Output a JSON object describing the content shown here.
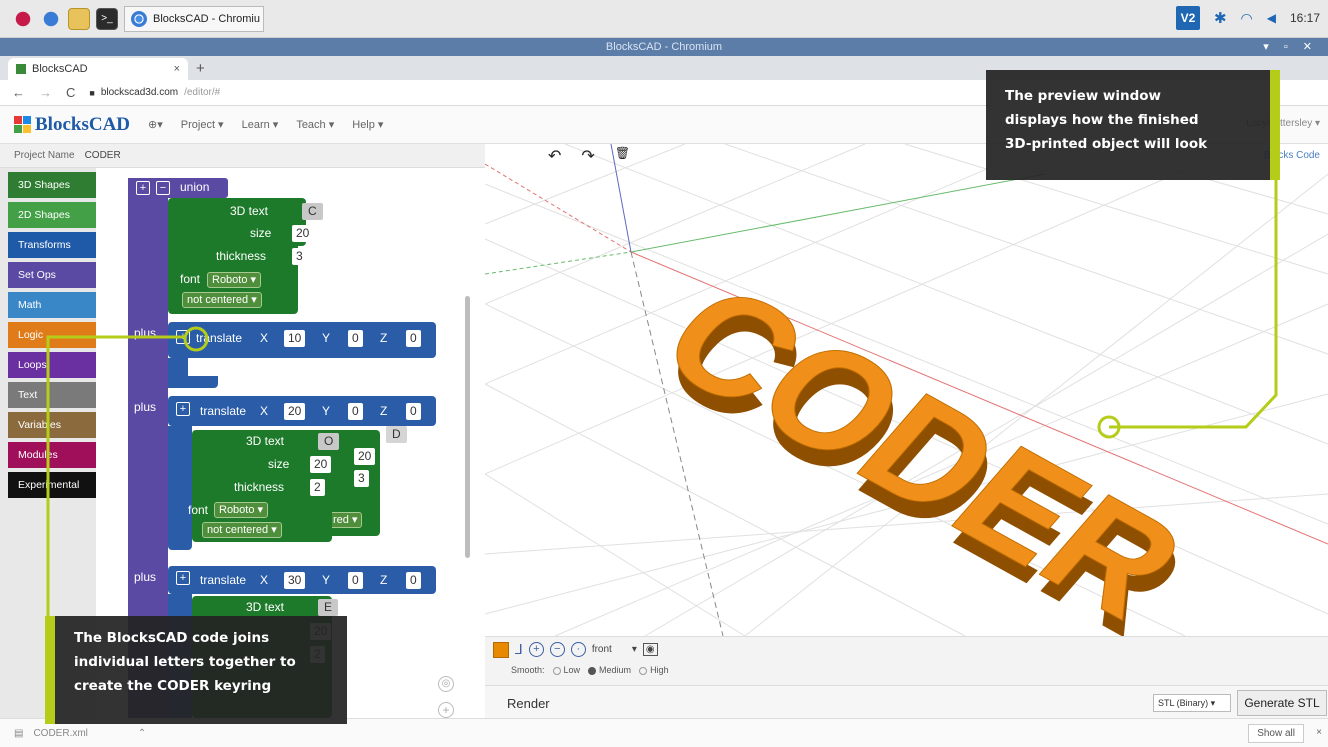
{
  "taskbar": {
    "task_label": "BlocksCAD - Chromiu",
    "vnc_label": "V2",
    "clock": "16:17"
  },
  "window": {
    "title": "BlocksCAD - Chromium",
    "controls": "▾ ▫ ✕"
  },
  "browser": {
    "tab_title": "BlocksCAD",
    "url_host": "blockscad3d.com",
    "url_path": "/editor/#"
  },
  "app": {
    "logo": "BlocksCAD",
    "globe": "⊕▾",
    "nav": [
      "Project ▾",
      "Learn ▾",
      "Teach ▾",
      "Help ▾"
    ],
    "user": "LucyHattersley ▾",
    "project_label": "Project Name",
    "project_name": "CODER"
  },
  "categories": [
    {
      "label": "3D Shapes",
      "color": "#2e7d32"
    },
    {
      "label": "2D Shapes",
      "color": "#43a047"
    },
    {
      "label": "Transforms",
      "color": "#1e5aa8"
    },
    {
      "label": "Set Ops",
      "color": "#5b4aa3"
    },
    {
      "label": "Math",
      "color": "#3a87c8"
    },
    {
      "label": "Logic",
      "color": "#e07b1a"
    },
    {
      "label": "Loops",
      "color": "#6a2fa0"
    },
    {
      "label": "Text",
      "color": "#7a7a7a"
    },
    {
      "label": "Variables",
      "color": "#8b6b3d"
    },
    {
      "label": "Modules",
      "color": "#a0105a"
    },
    {
      "label": "Experimental",
      "color": "#111111"
    }
  ],
  "blocks": {
    "union": "union",
    "plus": "plus",
    "text3d": "3D text",
    "size": "size",
    "thickness": "thickness",
    "font": "font",
    "font_value": "Roboto ▾",
    "centering": "not centered ▾",
    "translate": "translate",
    "x": "X",
    "y": "Y",
    "z": "Z",
    "letter1": "C",
    "letter2": "O",
    "letter3": "E",
    "size_val": "20",
    "thick1": "3",
    "thick2": "2",
    "tx1": "10",
    "tx2": "20",
    "tx3": "30",
    "zero": "0",
    "ghost_size": "20",
    "ghost_thick": "3",
    "ghost_letter": "D",
    "ghost_centered": "red ▾"
  },
  "viewer": {
    "word": "CODER",
    "toolbar": [
      "↶",
      "↷",
      "🗑"
    ],
    "tabs": "Blocks  Code"
  },
  "render_panel": {
    "view": "front",
    "smooth_label": "Smooth:",
    "smooth_options": [
      "Low",
      "Medium",
      "High"
    ],
    "smooth_selected": "Medium",
    "render_label": "Render",
    "format": "STL (Binary) ▾",
    "generate_label": "Generate STL"
  },
  "download_shelf": {
    "file": "CODER.xml",
    "show_all": "Show all"
  },
  "callouts": {
    "viewer": [
      "The preview window",
      "displays how the finished",
      "3D-printed object will look"
    ],
    "code": [
      "The BlocksCAD code joins",
      "individual letters together to",
      "create the CODER keyring"
    ]
  },
  "colors": {
    "accent": "#b5cc18",
    "object": "#f0901a",
    "block_green": "#1d7a2a",
    "block_blue": "#2a5ca8",
    "block_purple": "#5b4aa3"
  }
}
